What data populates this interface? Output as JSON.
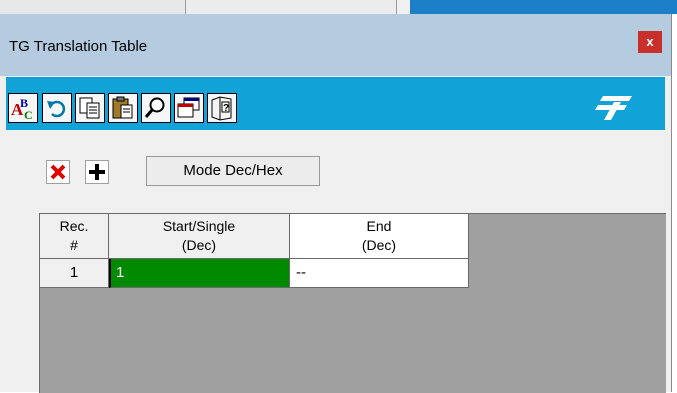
{
  "window": {
    "title": "TG Translation Table",
    "close_label": "x"
  },
  "toolbar": {
    "buttons": [
      {
        "icon": "spell-check-icon"
      },
      {
        "icon": "undo-icon"
      },
      {
        "icon": "copy-icon"
      },
      {
        "icon": "paste-icon"
      },
      {
        "icon": "find-icon"
      },
      {
        "icon": "cascade-windows-icon"
      },
      {
        "icon": "help-book-icon"
      }
    ],
    "logo": "brand-logo-icon",
    "color": "#11a2d8"
  },
  "actions": {
    "delete_icon": "red-x-icon",
    "add_icon": "plus-icon",
    "mode_label": "Mode Dec/Hex"
  },
  "table": {
    "headers": {
      "rec": {
        "line1": "Rec.",
        "line2": "#"
      },
      "start": {
        "line1": "Start/Single",
        "line2": "(Dec)"
      },
      "end": {
        "line1": "End",
        "line2": "(Dec)"
      }
    },
    "rows": [
      {
        "rec": "1",
        "start": "1",
        "end": "--"
      }
    ],
    "selected_cell_color": "#008a00"
  }
}
